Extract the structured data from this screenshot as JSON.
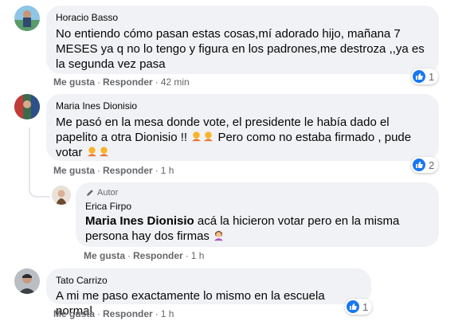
{
  "comments": [
    {
      "author": "Horacio Basso",
      "text": "No entiendo cómo pasan estas cosas,mí adorado hijo, mañana 7 MESES ya q no lo tengo y figura en los padrones,me destroza ,,ya es la segunda vez pasa",
      "like_label": "Me gusta",
      "reply_label": "Responder",
      "time": "42 min",
      "reaction_count": "1"
    },
    {
      "author": "Maria Ines Dionisio",
      "text_line1": "Me pasó en la mesa donde vote, el presidente le había dado el",
      "text_line2a": "papelito a otra Dionisio !!",
      "text_line2b": "Pero como no estaba firmado , pude",
      "text_line3": "votar",
      "like_label": "Me gusta",
      "reply_label": "Responder",
      "time": "1 h",
      "reaction_count": "2"
    },
    {
      "badge": "Autor",
      "author": "Erica Firpo",
      "mention": "Maria Ines Dionisio",
      "text_after_mention": " acá la hicieron votar pero en la misma",
      "text_line2": "persona hay dos firmas",
      "like_label": "Me gusta",
      "reply_label": "Responder",
      "time": "1 h"
    },
    {
      "author": "Tato Carrizo",
      "text": "A mi me paso exactamente lo mismo en la escuela normal",
      "like_label": "Me gusta",
      "reply_label": "Responder",
      "time": "1 h",
      "reaction_count": "1"
    }
  ],
  "colors": {
    "bubble": "#f0f2f5",
    "like_blue": "#1877f2",
    "meta_gray": "#65676b"
  },
  "icons": [
    "thumbs-up-icon",
    "pencil-icon",
    "shrug-emoji",
    "shrug-woman-emoji"
  ]
}
